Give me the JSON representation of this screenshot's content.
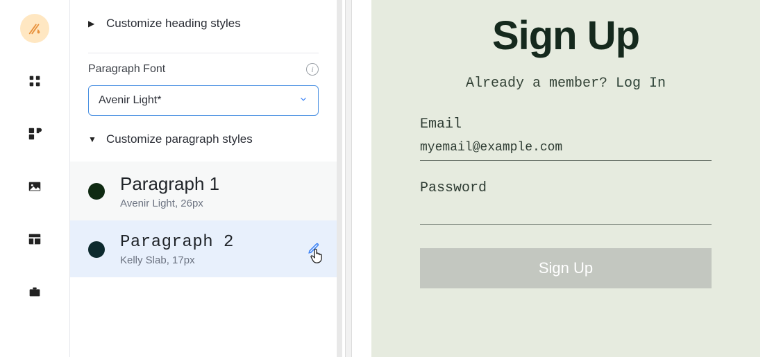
{
  "rail": {
    "icons": [
      "theme",
      "grid",
      "plugin",
      "image",
      "layout",
      "business"
    ]
  },
  "panel": {
    "heading_expander": "Customize heading styles",
    "paragraph_font_label": "Paragraph Font",
    "paragraph_font_value": "Avenir Light*",
    "paragraph_expander": "Customize paragraph styles",
    "styles": [
      {
        "name": "Paragraph 1",
        "meta": "Avenir Light, 26px"
      },
      {
        "name": "Paragraph 2",
        "meta": "Kelly Slab, 17px"
      }
    ]
  },
  "preview": {
    "title": "Sign Up",
    "already_text": "Already a member? ",
    "login_link": "Log In",
    "email_label": "Email",
    "email_value": "myemail@example.com",
    "password_label": "Password",
    "button_label": "Sign Up"
  }
}
